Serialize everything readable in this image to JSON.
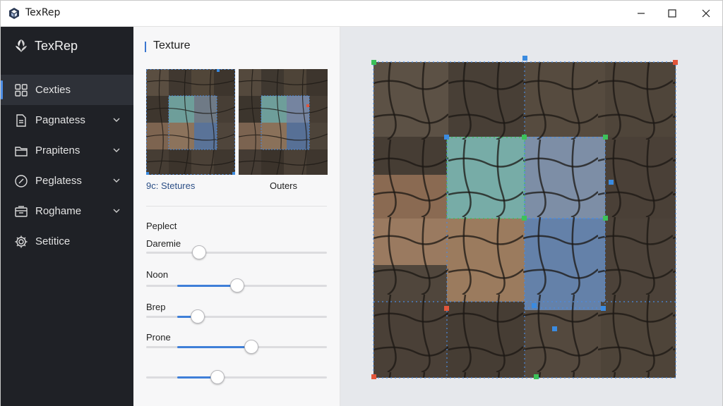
{
  "window": {
    "title": "TexRep"
  },
  "sidebar": {
    "brand": "TexRep",
    "items": [
      {
        "label": "Cexties",
        "icon": "grid-icon",
        "active": true,
        "expandable": false
      },
      {
        "label": "Pagnatess",
        "icon": "document-icon",
        "active": false,
        "expandable": true
      },
      {
        "label": "Prapitens",
        "icon": "folder-icon",
        "active": false,
        "expandable": true
      },
      {
        "label": "Peglatess",
        "icon": "compass-icon",
        "active": false,
        "expandable": true
      },
      {
        "label": "Roghame",
        "icon": "inbox-icon",
        "active": false,
        "expandable": true
      },
      {
        "label": "Setitice",
        "icon": "gear-icon",
        "active": false,
        "expandable": false
      }
    ]
  },
  "panel": {
    "title": "Texture",
    "thumbnails": [
      {
        "label": "9c: Stetures"
      },
      {
        "label": "Outers"
      }
    ],
    "section_label": "Peplect",
    "sliders": [
      {
        "label": "Daremie",
        "value": 0.29,
        "filled": false
      },
      {
        "label": "Noon",
        "value": 0.5,
        "filled": true
      },
      {
        "label": "Brep",
        "value": 0.28,
        "filled": true
      },
      {
        "label": "Prone",
        "value": 0.58,
        "filled": true
      },
      {
        "label": "",
        "value": 0.39,
        "filled": true
      }
    ]
  },
  "colors": {
    "accent": "#3f7fd8",
    "selection_teal": "#6fa3a0",
    "selection_blue": "#5f7fae",
    "selection_tan": "#9b7b5e",
    "tile_dark": "#4a4037",
    "corner_handle": "#e2563b",
    "green_handle": "#3cc25a",
    "blue_handle": "#3b8be0"
  }
}
